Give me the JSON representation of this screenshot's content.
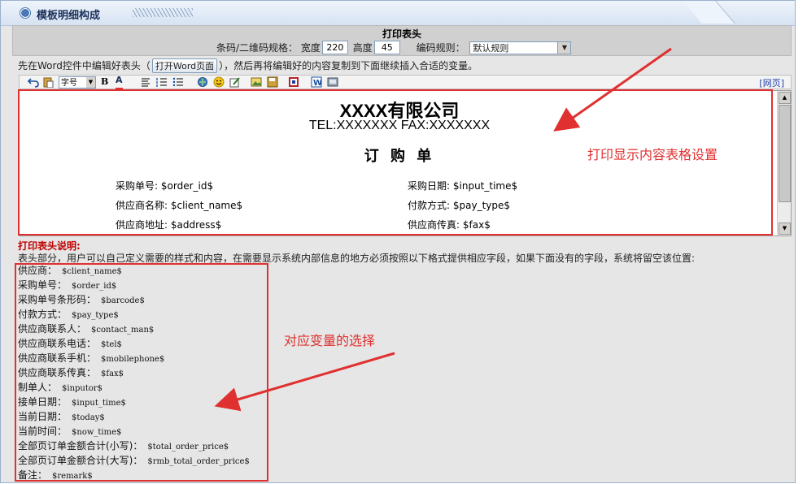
{
  "panel": {
    "title": "模板明细构成"
  },
  "print_header": {
    "section_title": "打印表头",
    "barcode_size_label": "条码/二维码规格：",
    "width_label": "宽度",
    "width_value": "220",
    "height_label": "高度",
    "height_value": "45",
    "encoding_label": "编码规则：",
    "encoding_value": "默认规则"
  },
  "hint": {
    "before": "先在Word控件中编辑好表头（",
    "button": "打开Word页面",
    "after": "），然后再将编辑好的内容复制到下面继续插入合适的变量。"
  },
  "toolbar": {
    "font_size_value": "字号",
    "web_label": "[网页]",
    "icons": [
      "undo-icon",
      "paste-icon",
      "font-size-select",
      "bold-icon",
      "font-color-icon",
      "align-icon",
      "ordered-list-icon",
      "unordered-list-icon",
      "link-icon",
      "emoticon-icon",
      "edit-icon",
      "image-icon",
      "save-icon",
      "flash-icon",
      "word-icon",
      "preview-icon"
    ]
  },
  "template": {
    "company": "XXXX有限公司",
    "telfax": "TEL:XXXXXXX  FAX:XXXXXXX",
    "title": "订 购 单",
    "fields": [
      {
        "label": "采购单号:",
        "value": "$order_id$"
      },
      {
        "label": "采购日期:",
        "value": "$input_time$"
      },
      {
        "label": "供应商名称:",
        "value": "$client_name$"
      },
      {
        "label": "付款方式:",
        "value": "$pay_type$"
      },
      {
        "label": "供应商地址:",
        "value": "$address$"
      },
      {
        "label": "供应商传真:",
        "value": "$fax$"
      }
    ]
  },
  "annotations": {
    "print_content": "打印显示内容表格设置",
    "variable_choice": "对应变量的选择"
  },
  "notes": {
    "title": "打印表头说明:",
    "description": "表头部分，用户可以自己定义需要的样式和内容，在需要显示系统内部信息的地方必须按照以下格式提供相应字段，如果下面没有的字段，系统将留空该位置:"
  },
  "variables": [
    {
      "label": "供应商：",
      "code": "$client_name$"
    },
    {
      "label": "采购单号：",
      "code": "$order_id$"
    },
    {
      "label": "采购单号条形码：",
      "code": "$barcode$"
    },
    {
      "label": "付款方式：",
      "code": "$pay_type$"
    },
    {
      "label": "供应商联系人：",
      "code": "$contact_man$"
    },
    {
      "label": "供应商联系电话：",
      "code": "$tel$"
    },
    {
      "label": "供应商联系手机：",
      "code": "$mobilephone$"
    },
    {
      "label": "供应商联系传真：",
      "code": "$fax$"
    },
    {
      "label": "制单人：",
      "code": "$inputor$"
    },
    {
      "label": "接单日期：",
      "code": "$input_time$"
    },
    {
      "label": "当前日期：",
      "code": "$today$"
    },
    {
      "label": "当前时间：",
      "code": "$now_time$"
    },
    {
      "label": "全部页订单金额合计(小写)：",
      "code": "$total_order_price$"
    },
    {
      "label": "全部页订单金额合计(大写)：",
      "code": "$rmb_total_order_price$"
    },
    {
      "label": "备注：",
      "code": "$remark$"
    }
  ],
  "colors": {
    "annotation_red": "#e03030",
    "title_blue": "#1b2f5a"
  }
}
